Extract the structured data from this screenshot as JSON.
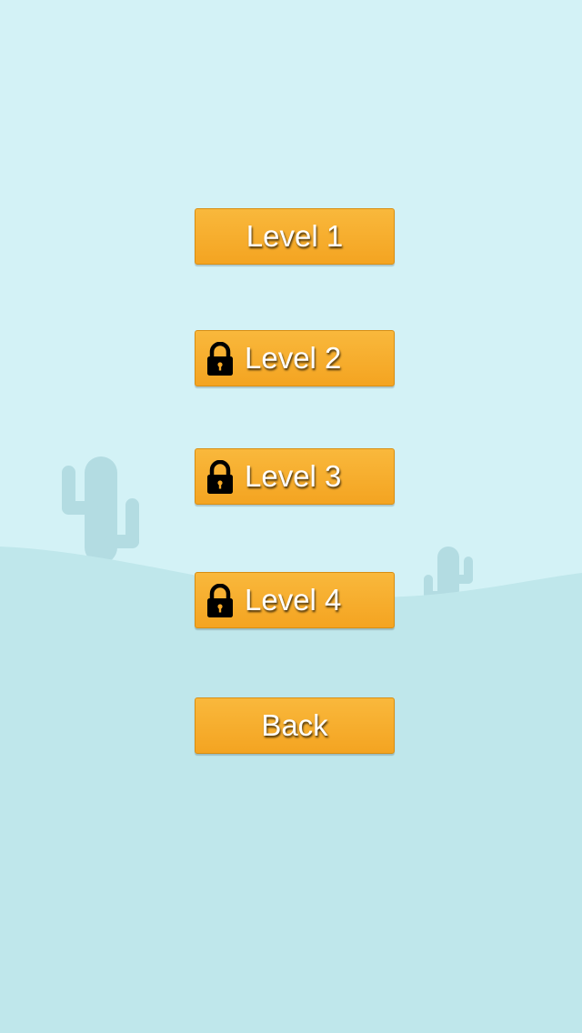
{
  "background": {
    "sky_color": "#d3f2f6",
    "ground_color": "#bfe7eb",
    "cactus_color": "#b3dce2",
    "decorations": [
      "cactus-icon",
      "cactus-icon"
    ]
  },
  "menu": {
    "buttons": [
      {
        "label": "Level 1",
        "locked": false,
        "icon": null
      },
      {
        "label": "Level 2",
        "locked": true,
        "icon": "lock-icon"
      },
      {
        "label": "Level 3",
        "locked": true,
        "icon": "lock-icon"
      },
      {
        "label": "Level 4",
        "locked": true,
        "icon": "lock-icon"
      },
      {
        "label": "Back",
        "locked": false,
        "icon": null
      }
    ],
    "button_color": "#f6a825",
    "label_color": "#ffffff"
  }
}
